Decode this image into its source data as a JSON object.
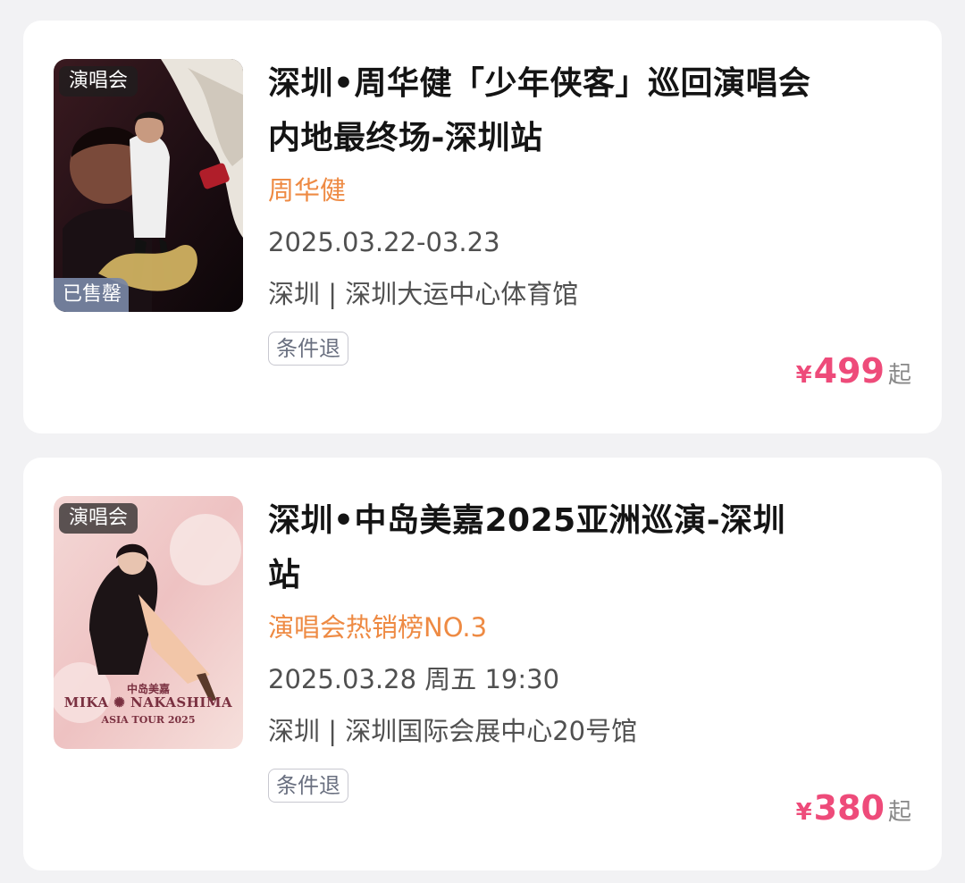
{
  "events": [
    {
      "tag": "演唱会",
      "status": "已售罄",
      "title_line1": "深圳•周华健「少年侠客」巡回演唱会",
      "title_line2": "内地最终场-深圳站",
      "subtitle": "周华健",
      "date": "2025.03.22-03.23",
      "venue": "深圳 | 深圳大运中心体育馆",
      "refund": "条件退",
      "price_symbol": "¥",
      "price": "499",
      "price_suffix": "起"
    },
    {
      "tag": "演唱会",
      "title_line1": "深圳•中岛美嘉2025亚洲巡演-深圳",
      "title_line2": "站",
      "subtitle": "演唱会热销榜NO.3",
      "date": "2025.03.28 周五 19:30",
      "venue": "深圳 | 深圳国际会展中心20号馆",
      "refund": "条件退",
      "price_symbol": "¥",
      "price": "380",
      "price_suffix": "起",
      "poster_text": {
        "cn_name": "中岛美嘉",
        "en_name": "MIKA ✺ NAKASHIMA",
        "tour": "ASIA TOUR 2025"
      }
    }
  ]
}
